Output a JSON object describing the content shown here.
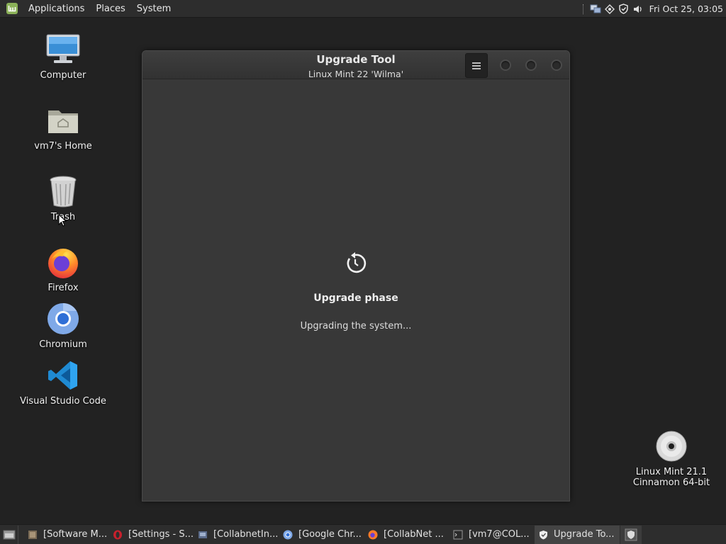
{
  "top_panel": {
    "menus": [
      "Applications",
      "Places",
      "System"
    ],
    "clock": "Fri Oct 25, 03:05"
  },
  "desktop_icons": [
    {
      "label": "Computer",
      "icon": "computer-icon"
    },
    {
      "label": "vm7's Home",
      "icon": "home-folder-icon"
    },
    {
      "label": "Trash",
      "icon": "trash-icon"
    },
    {
      "label": "Firefox",
      "icon": "firefox-icon"
    },
    {
      "label": "Chromium",
      "icon": "chromium-icon"
    },
    {
      "label": "Visual Studio Code",
      "icon": "vscode-icon"
    },
    {
      "label_line1": "Linux Mint 21.1",
      "label_line2": "Cinnamon 64-bit",
      "icon": "disc-icon"
    }
  ],
  "window": {
    "title": "Upgrade Tool",
    "subtitle": "Linux Mint 22 'Wilma'",
    "phase_title": "Upgrade phase",
    "phase_status": "Upgrading the system..."
  },
  "taskbar": {
    "tasks": [
      {
        "label": "[Software M...",
        "icon": "software-manager-icon"
      },
      {
        "label": "[Settings - S...",
        "icon": "opera-icon"
      },
      {
        "label": "[CollabnetIn...",
        "icon": "installer-icon"
      },
      {
        "label": "[Google Chr...",
        "icon": "chrome-icon"
      },
      {
        "label": "[CollabNet ...",
        "icon": "firefox-icon"
      },
      {
        "label": "[vm7@COL...",
        "icon": "terminal-icon"
      },
      {
        "label": "Upgrade To...",
        "icon": "shield-icon"
      }
    ]
  },
  "colors": {
    "desktop_bg": "#222222",
    "panel_bg": "#2d2d2d",
    "window_bg": "#383838",
    "mint_green": "#8bb158"
  }
}
